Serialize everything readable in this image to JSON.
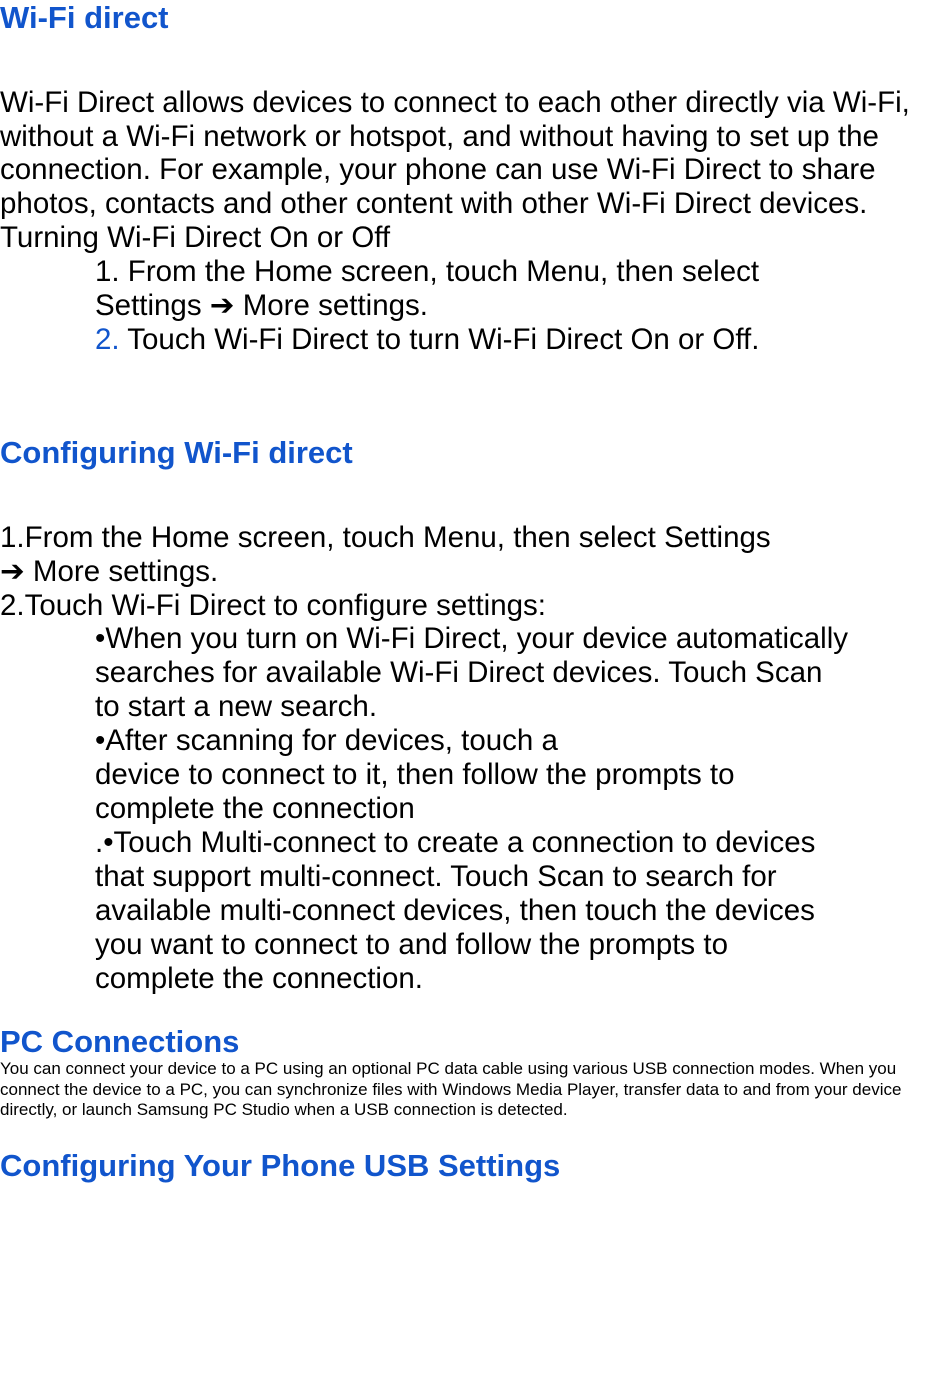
{
  "sections": {
    "wifiDirect": {
      "heading": "Wi-Fi direct",
      "intro": "Wi-Fi Direct allows devices to connect to each other directly via Wi-Fi, without a Wi-Fi network or hotspot, and without having to set up the connection. For example, your phone can use Wi-Fi Direct to share photos, contacts and other content with other Wi-Fi Direct devices.",
      "subTitle": "Turning Wi-Fi Direct On or Off",
      "steps": {
        "s1a": "1. From the Home screen, touch Menu, then select ",
        "s1b": "Settings  ➔  More settings.",
        "s2num": "2.",
        "s2text": " Touch Wi-Fi Direct    to turn Wi-Fi Direct On or Off."
      }
    },
    "config": {
      "heading": "Configuring Wi-Fi direct",
      "s1a": "1.From the Home screen, touch    Menu, then select Settings ",
      "s1b": "➔  More settings.",
      "s2": "2.Touch Wi-Fi Direct to configure settings:",
      "bullets": {
        "b1a": "•When you turn on Wi-Fi Direct, your device automatically ",
        "b1b": "  searches for available Wi-Fi Direct devices. Touch Scan ",
        "b1c": "to start a new search.",
        "b2a": "•After scanning for devices, touch a",
        "b2b": "device to connect to it, then follow the prompts to ",
        "b2c": "complete the connection",
        "b3a": ".•Touch Multi-connect to create a connection to devices ",
        "b3b": "that support multi-connect. Touch Scan to search for ",
        "b3c": "available multi-connect devices, then touch the devices ",
        "b3d": "you want to connect to and follow the prompts to ",
        "b3e": "complete the connection."
      }
    },
    "pc": {
      "heading": "PC Connections",
      "text": "You can connect your device to a PC using an optional PC data cable using various USB connection modes. When you connect the device to a PC, you can synchronize files with Windows Media Player, transfer data to and from your device directly, or launch Samsung PC Studio when a USB connection is detected."
    },
    "usb": {
      "heading": "Configuring Your Phone USB Settings"
    }
  }
}
